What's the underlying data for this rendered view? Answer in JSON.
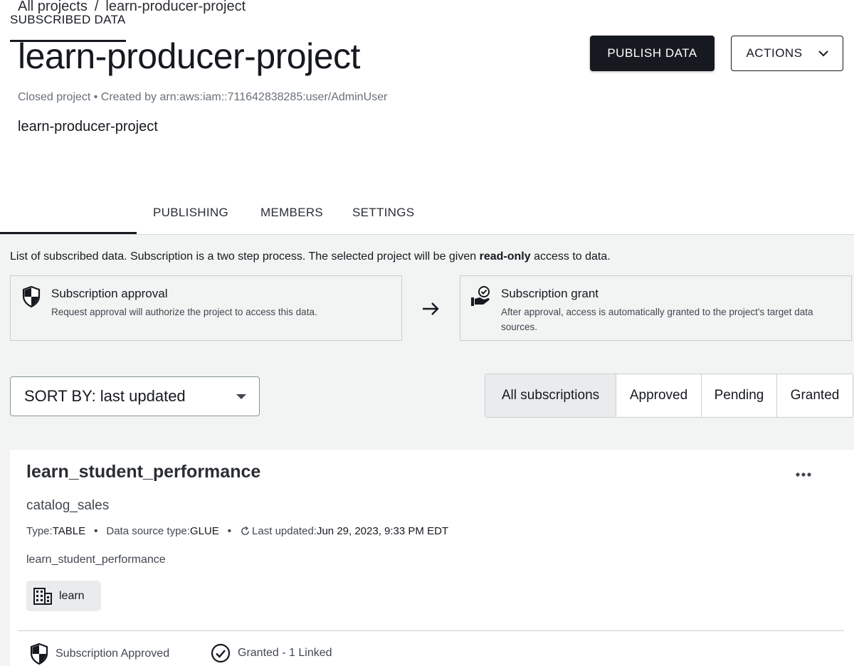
{
  "breadcrumb": {
    "root": "All projects",
    "separator": "/",
    "current": "learn-producer-project"
  },
  "header": {
    "title": "learn-producer-project",
    "meta": "Closed project • Created by arn:aws:iam::711642838285:user/AdminUser",
    "description": "learn-producer-project",
    "publish_label": "PUBLISH DATA",
    "actions_label": "ACTIONS"
  },
  "tabs": [
    {
      "label": "SUBSCRIBED DATA",
      "active": true
    },
    {
      "label": "PUBLISHING",
      "active": false
    },
    {
      "label": "MEMBERS",
      "active": false
    },
    {
      "label": "SETTINGS",
      "active": false
    }
  ],
  "intro": {
    "before": "List of subscribed data. Subscription is a two step process. The selected project will be given ",
    "bold": "read-only",
    "after": " access to data."
  },
  "steps": [
    {
      "title": "Subscription approval",
      "text": "Request approval will authorize the project to access this data.",
      "icon": "shield-icon"
    },
    {
      "title": "Subscription grant",
      "text": "After approval, access is automatically granted to the project's target data sources.",
      "icon": "grant-hand-icon"
    }
  ],
  "sort": {
    "label": "SORT BY: last updated"
  },
  "filters": [
    "All subscriptions",
    "Approved",
    "Pending",
    "Granted"
  ],
  "subscription": {
    "title": "learn_student_performance",
    "asset_name": "catalog_sales",
    "type_label": "Type:",
    "type_value": "TABLE",
    "source_label": "Data source type:",
    "source_value": "GLUE",
    "updated_label": "Last updated:",
    "updated_value": "Jun 29, 2023, 9:33 PM EDT",
    "description": "learn_student_performance",
    "project_tag": "learn",
    "approval_status": "Subscription Approved",
    "grant_status": "Granted - 1 Linked"
  },
  "colors": {
    "primary_button": "#16191f",
    "page_background": "#f2f3f3",
    "selected_filter": "#e9ebed"
  }
}
